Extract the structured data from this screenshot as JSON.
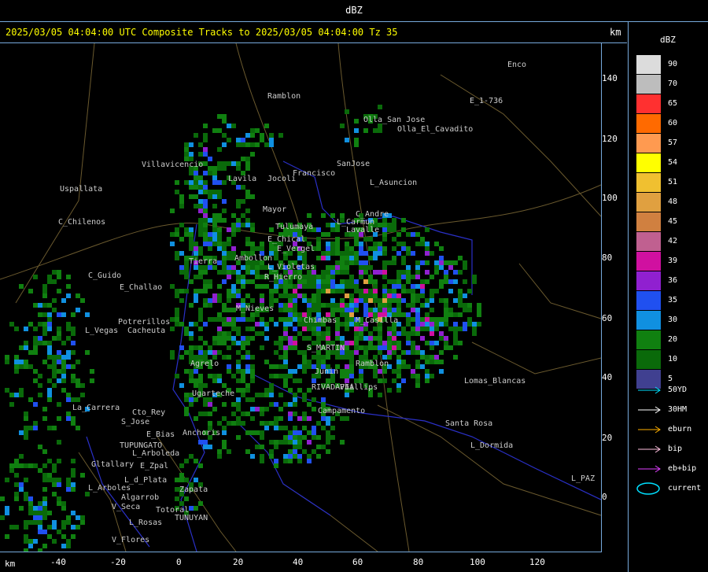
{
  "top_title": "dBZ",
  "header": {
    "text": "2025/03/05 04:04:00 UTC Composite Tracks to 2025/03/05 04:04:00 Tz 35",
    "km_label": "km"
  },
  "bottom_axis": {
    "km_label": "km",
    "ticks": [
      "-40",
      "-20",
      "0",
      "20",
      "40",
      "60",
      "80",
      "100",
      "120"
    ]
  },
  "right_axis": {
    "ticks": [
      "140",
      "120",
      "100",
      "80",
      "60",
      "40",
      "20",
      "0"
    ]
  },
  "legend": {
    "title": "dBZ",
    "scale": [
      {
        "label": "90",
        "color": "#dcdcdc"
      },
      {
        "label": "70",
        "color": "#bdbdbd"
      },
      {
        "label": "65",
        "color": "#ff3030"
      },
      {
        "label": "60",
        "color": "#ff6a00"
      },
      {
        "label": "57",
        "color": "#ff9a50"
      },
      {
        "label": "54",
        "color": "#ffff00"
      },
      {
        "label": "51",
        "color": "#f0c030"
      },
      {
        "label": "48",
        "color": "#e0a040"
      },
      {
        "label": "45",
        "color": "#d08040"
      },
      {
        "label": "42",
        "color": "#c06090"
      },
      {
        "label": "39",
        "color": "#d010a0"
      },
      {
        "label": "36",
        "color": "#9020d0"
      },
      {
        "label": "35",
        "color": "#2050f0"
      },
      {
        "label": "30",
        "color": "#1090e0"
      },
      {
        "label": "20",
        "color": "#108010"
      },
      {
        "label": "10",
        "color": "#0a6a0a"
      },
      {
        "label": "5",
        "color": "#404090"
      }
    ],
    "tracks": [
      {
        "label": "50YD",
        "color": "#00e0ff"
      },
      {
        "label": "30HM",
        "color": "#ffffff"
      },
      {
        "label": "eburn",
        "color": "#ffb000"
      },
      {
        "label": "bip",
        "color": "#ffc0e0"
      },
      {
        "label": "eb+bip",
        "color": "#e040ff"
      },
      {
        "label": "current",
        "color": "#00e0ff"
      }
    ]
  },
  "places": [
    {
      "name": "Ramblon"
    },
    {
      "name": "Enco"
    },
    {
      "name": "E_1-736"
    },
    {
      "name": "Olla_San Jose"
    },
    {
      "name": "Olla_El_Cavadito"
    },
    {
      "name": "SanJose"
    },
    {
      "name": "Francisco"
    },
    {
      "name": "L_Asuncion"
    },
    {
      "name": "Uspallata"
    },
    {
      "name": "C_Chilenos"
    },
    {
      "name": "C_Guido"
    },
    {
      "name": "E_Challao"
    },
    {
      "name": "Potrerillos"
    },
    {
      "name": "L_Vegas"
    },
    {
      "name": "Cacheuta"
    },
    {
      "name": "Agrelo"
    },
    {
      "name": "Ugarteche"
    },
    {
      "name": "La_Carrera"
    },
    {
      "name": "Cto_Rey"
    },
    {
      "name": "S_Jose"
    },
    {
      "name": "TUPUNGATO"
    },
    {
      "name": "Anchoris"
    },
    {
      "name": "L_Arboleda"
    },
    {
      "name": "Gltallary"
    },
    {
      "name": "E_Zpal"
    },
    {
      "name": "L_d_Plata"
    },
    {
      "name": "L_Arboles"
    },
    {
      "name": "Algarrob"
    },
    {
      "name": "Zapata"
    },
    {
      "name": "V_Seca"
    },
    {
      "name": "L_Rosas"
    },
    {
      "name": "TUNUYAN"
    },
    {
      "name": "V_Flores"
    },
    {
      "name": "Mayor"
    },
    {
      "name": "E_Chical"
    },
    {
      "name": "E_Vergel"
    },
    {
      "name": "C_Andre"
    },
    {
      "name": "L_Carmun"
    },
    {
      "name": "S_MARTIN"
    },
    {
      "name": "RIVADAVIA"
    },
    {
      "name": "Lomas_Blancas"
    },
    {
      "name": "L_Dormida"
    },
    {
      "name": "Santa Rosa"
    },
    {
      "name": "L_PAZ"
    },
    {
      "name": "Chimbas"
    },
    {
      "name": "M_Casilla"
    },
    {
      "name": "Ramblon"
    },
    {
      "name": "Phillips"
    },
    {
      "name": "Campamento"
    },
    {
      "name": "Junin"
    },
    {
      "name": "Lavalle"
    },
    {
      "name": "L_Violetas"
    },
    {
      "name": "Ambollon"
    },
    {
      "name": "R_Hierro"
    },
    {
      "name": "Tulumaya"
    },
    {
      "name": "Jocoli"
    },
    {
      "name": "Villavicencio"
    },
    {
      "name": "Lavila"
    },
    {
      "name": "M_Nieves"
    },
    {
      "name": "E_Bias"
    },
    {
      "name": "Tierra"
    },
    {
      "name": "Totoral"
    }
  ]
}
